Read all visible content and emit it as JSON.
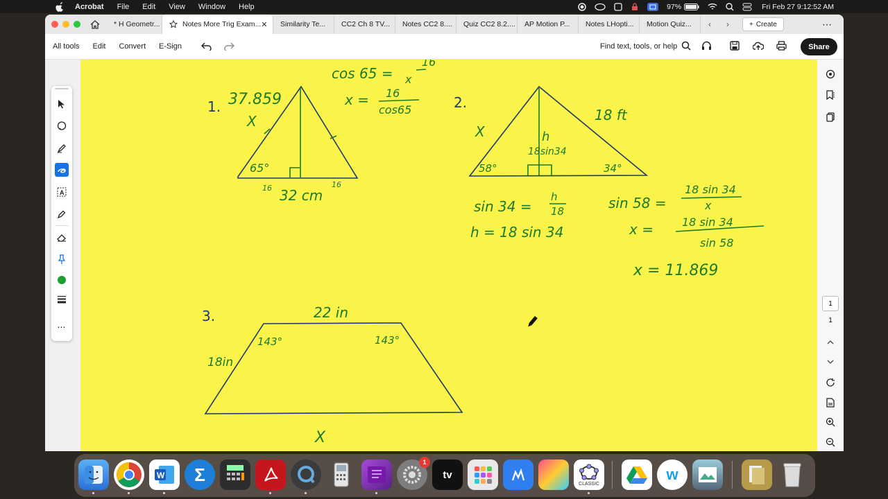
{
  "menubar": {
    "app": "Acrobat",
    "items": [
      "File",
      "Edit",
      "View",
      "Window",
      "Help"
    ],
    "battery": "97%",
    "clock": "Fri Feb 27  9:12:52 AM"
  },
  "tabs": {
    "home_tab": "* H Geometr...",
    "active_tab": "Notes More Trig Exam...",
    "others": [
      "Similarity Te...",
      "CC2 Ch 8 TV...",
      "Notes CC2 8....",
      "Quiz CC2 8.2....",
      "AP Motion P...",
      "Notes LHopti...",
      "Motion Quiz..."
    ],
    "create": "Create"
  },
  "toolbar": {
    "all_tools": "All tools",
    "edit": "Edit",
    "convert": "Convert",
    "esign": "E-Sign",
    "find": "Find text, tools, or help",
    "share": "Share"
  },
  "pagination": {
    "current": "1",
    "total": "1"
  },
  "handwriting": {
    "p1_num": "1.",
    "p1_value": "37.859",
    "p1_x": "X",
    "p1_angle": "65°",
    "p1_base": "32 cm",
    "p1_half_left": "16",
    "p1_half_right": "16",
    "cos_eq_lhs": "cos 65 =",
    "cos_eq_num": "16",
    "cos_eq_den": "x",
    "x_eq_lhs": "x =",
    "x_eq_num": "16",
    "x_eq_den": "cos65",
    "p2_num": "2.",
    "p2_x": "X",
    "p2_hyp": "18 ft",
    "p2_h": "h",
    "p2_h_expr": "18sin34",
    "p2_angle_left": "58°",
    "p2_angle_right": "34°",
    "sin34_lhs": "sin 34 =",
    "sin34_num": "h",
    "sin34_den": "18",
    "h_eq": "h = 18 sin 34",
    "sin58_lhs": "sin 58 =",
    "sin58_num": "18 sin 34",
    "sin58_den": "x",
    "x2_lhs": "x =",
    "x2_num": "18 sin 34",
    "x2_den": "sin 58",
    "x2_result": "x = 11.869",
    "p3_num": "3.",
    "p3_top": "22 in",
    "p3_side": "18in",
    "p3_angle_left": "143°",
    "p3_angle_right": "143°",
    "p3_x": "X"
  },
  "dock": {
    "apps": [
      "Finder",
      "Chrome",
      "Word",
      "Sigma",
      "Calculator",
      "Acrobat",
      "QuickTime",
      "Graphing Calculator",
      "OneNote",
      "System Settings",
      "Apple TV",
      "Launchpad",
      "Pages Tool",
      "Sketchbook",
      "GeoGebra Classic",
      "Google Drive",
      "Webex",
      "Preview",
      "Documents",
      "Trash"
    ],
    "settings_badge": "1",
    "geogebra_label": "CLASSIC"
  }
}
